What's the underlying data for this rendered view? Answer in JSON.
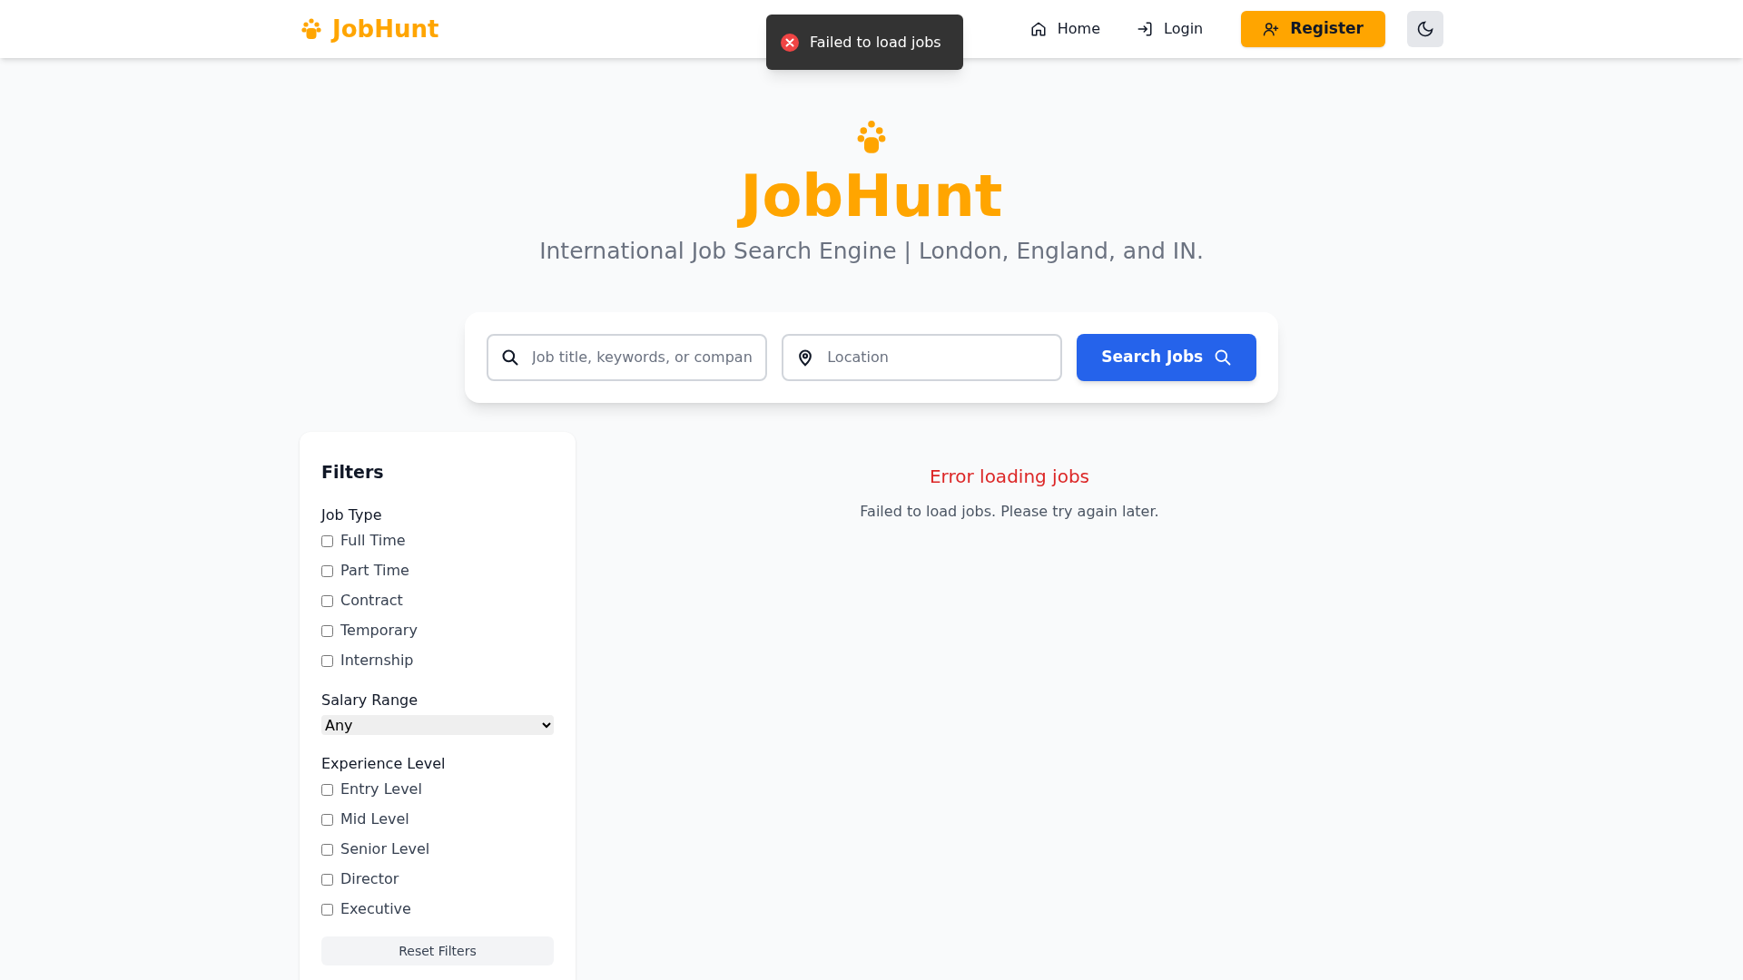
{
  "header": {
    "logo": "JobHunt",
    "nav": [
      {
        "kind": "home",
        "label": "Home"
      },
      {
        "kind": "login",
        "label": "Login"
      },
      {
        "kind": "register",
        "label": "Register"
      }
    ]
  },
  "toast": {
    "message": "Failed to load jobs"
  },
  "hero": {
    "title": "JobHunt",
    "subtitle": "International Job Search Engine | London, England, and IN."
  },
  "search": {
    "keyword_placeholder": "Job title, keywords, or compan",
    "location_placeholder": "Location",
    "button": "Search Jobs"
  },
  "filters": {
    "title": "Filters",
    "job_type": {
      "label": "Job Type",
      "options": [
        {
          "label": "Full Time",
          "checked": false
        },
        {
          "label": "Part Time",
          "checked": false
        },
        {
          "label": "Contract",
          "checked": false
        },
        {
          "label": "Temporary",
          "checked": false
        },
        {
          "label": "Internship",
          "checked": false
        }
      ]
    },
    "salary": {
      "label": "Salary Range",
      "value": "Any"
    },
    "experience": {
      "label": "Experience Level",
      "options": [
        {
          "label": "Entry Level",
          "checked": false
        },
        {
          "label": "Mid Level",
          "checked": false
        },
        {
          "label": "Senior Level",
          "checked": false
        },
        {
          "label": "Director",
          "checked": false
        },
        {
          "label": "Executive",
          "checked": false
        }
      ]
    },
    "reset_button": "Reset Filters"
  },
  "results": {
    "error_title": "Error loading jobs",
    "error_message": "Failed to load jobs. Please try again later."
  }
}
